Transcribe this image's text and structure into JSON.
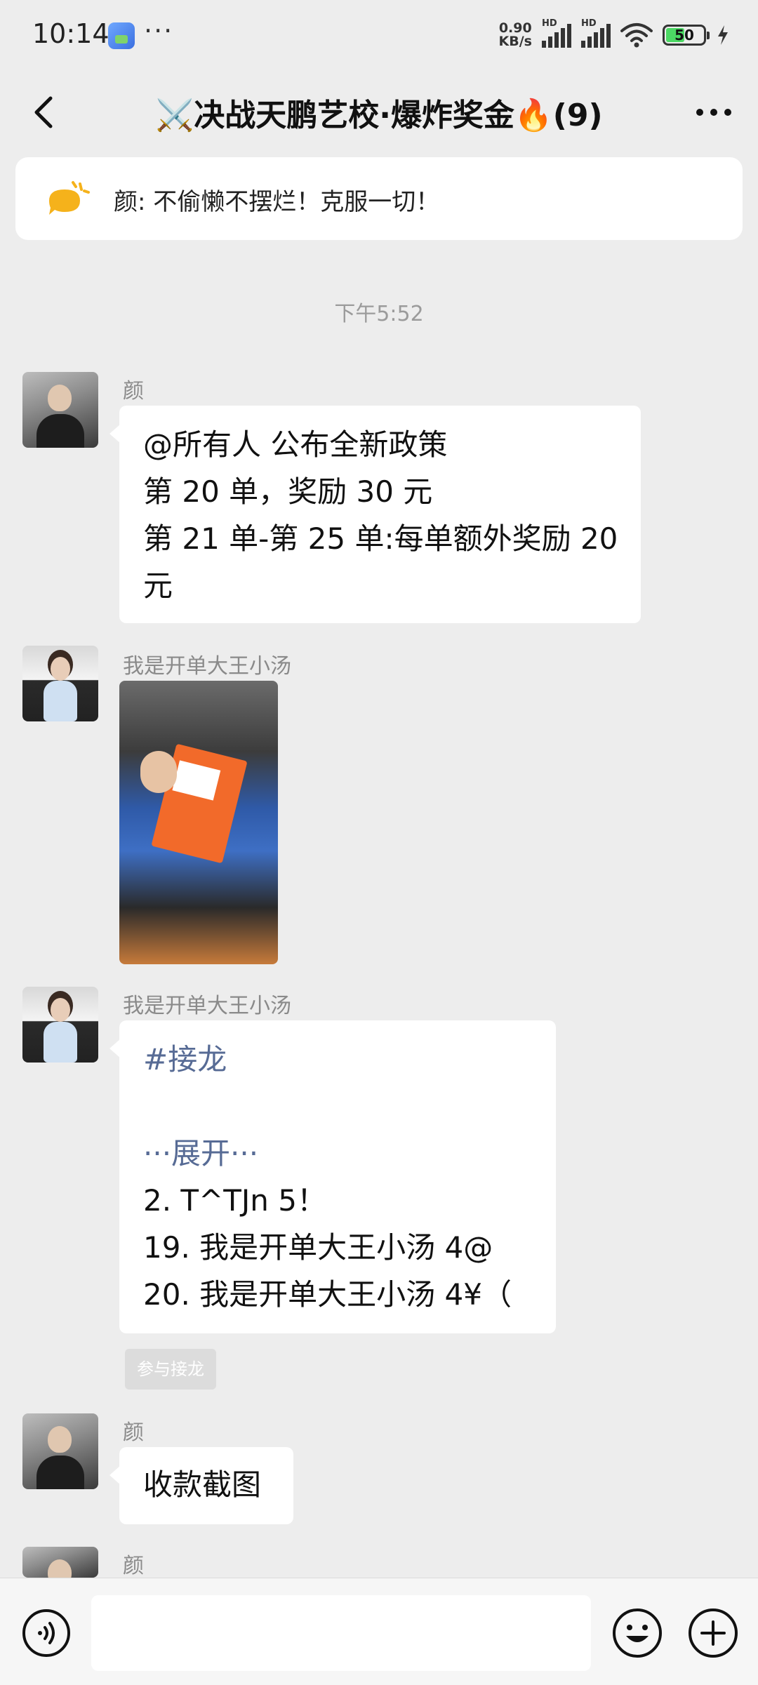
{
  "status_bar": {
    "time": "10:14",
    "dots": "···",
    "net_speed_value": "0.90",
    "net_speed_unit": "KB/s",
    "hd_label": "HD",
    "battery_level": "50",
    "battery_fraction": 0.5,
    "accent_color": "#4CD964"
  },
  "nav": {
    "title": "⚔️决战天鹏艺校·爆炸奖金🔥(9)"
  },
  "notice": {
    "text": "颜: 不偷懒不摆烂！克服一切！",
    "icon": "speech-bubble-icon",
    "icon_color": "#F5B21B"
  },
  "chat": {
    "timestamp": "下午5:52",
    "messages": [
      {
        "sender": "颜",
        "lines": [
          "@所有人  公布全新政策",
          "第 20 单，奖励 30 元",
          "第 21 单-第 25 单:每单额外奖励 20",
          "元"
        ]
      },
      {
        "sender": "我是开单大王小汤",
        "type": "image"
      },
      {
        "sender": "我是开单大王小汤",
        "lines": [
          "#接龙",
          "",
          "···展开···",
          "2. T^TJn 5！",
          "19. 我是开单大王小汤 4@",
          "20. 我是开单大王小汤 4¥（"
        ],
        "join_label": "参与接龙"
      },
      {
        "sender": "颜",
        "lines": [
          "收款截图"
        ]
      },
      {
        "sender": "颜"
      }
    ]
  },
  "input_bar": {
    "placeholder": ""
  }
}
